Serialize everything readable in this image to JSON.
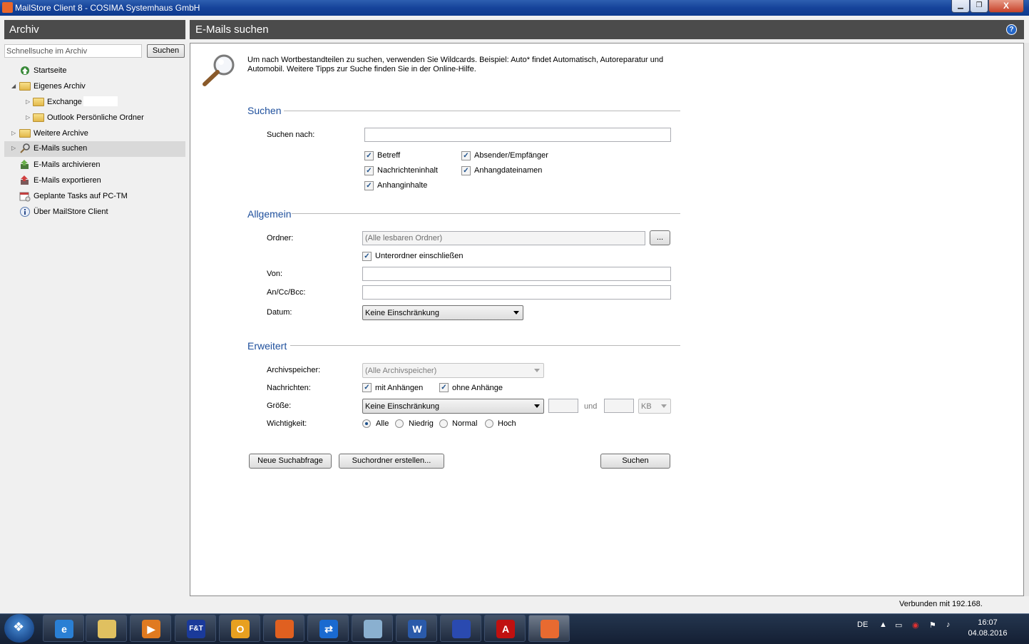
{
  "window": {
    "title": "MailStore Client 8 - COSIMA Systemhaus GmbH",
    "minimize": "▁",
    "maximize": "❐",
    "close": "X"
  },
  "left_pane": {
    "header": "Archiv",
    "quick_search_placeholder": "Schnellsuche im Archiv",
    "quick_search_button": "Suchen",
    "tree": [
      {
        "label": "Startseite",
        "icon": "home-icon"
      },
      {
        "label": "Eigenes Archiv",
        "icon": "folder-icon"
      },
      {
        "label": "Exchange",
        "icon": "folder-icon"
      },
      {
        "label": "Outlook Persönliche Ordner",
        "icon": "folder-icon"
      },
      {
        "label": "Weitere Archive",
        "icon": "folder-icon"
      },
      {
        "label": "E-Mails suchen",
        "icon": "search-icon"
      },
      {
        "label": "E-Mails archivieren",
        "icon": "archive-icon"
      },
      {
        "label": "E-Mails exportieren",
        "icon": "export-icon"
      },
      {
        "label": "Geplante Tasks auf PC-TM",
        "icon": "calendar-icon"
      },
      {
        "label": "Über MailStore Client",
        "icon": "info-icon"
      }
    ]
  },
  "main": {
    "header": "E-Mails suchen",
    "help": "?",
    "intro": "Um nach Wortbestandteilen zu suchen, verwenden Sie Wildcards. Beispiel: Auto* findet Automatisch, Autoreparatur und Automobil. Weitere Tipps zur Suche finden Sie in der Online-Hilfe.",
    "section_search": {
      "title": "Suchen",
      "search_for_label": "Suchen nach:",
      "search_for_value": "",
      "checkboxes": [
        "Betreff",
        "Absender/Empfänger",
        "Nachrichteninhalt",
        "Anhangdateinamen",
        "Anhanginhalte"
      ]
    },
    "section_general": {
      "title": "Allgemein",
      "folder_label": "Ordner:",
      "folder_value": "(Alle lesbaren Ordner)",
      "browse_button": "...",
      "include_subfolders": "Unterordner einschließen",
      "from_label": "Von:",
      "to_label": "An/Cc/Bcc:",
      "date_label": "Datum:",
      "date_value": "Keine Einschränkung"
    },
    "section_advanced": {
      "title": "Erweitert",
      "store_label": "Archivspeicher:",
      "store_value": "(Alle Archivspeicher)",
      "messages_label": "Nachrichten:",
      "with_attachments": "mit Anhängen",
      "without_attachments": "ohne Anhänge",
      "size_label": "Größe:",
      "size_value": "Keine Einschränkung",
      "size_and": "und",
      "size_unit": "KB",
      "priority_label": "Wichtigkeit:",
      "priority_options": [
        "Alle",
        "Niedrig",
        "Normal",
        "Hoch"
      ],
      "priority_selected": "Alle"
    },
    "buttons": {
      "new_query": "Neue Suchabfrage",
      "create_search_folder": "Suchordner erstellen...",
      "search": "Suchen"
    }
  },
  "status_bar": {
    "connection": "Verbunden mit 192.168."
  },
  "taskbar": {
    "apps": [
      {
        "icon": "internet-explorer-icon",
        "glyph": "e",
        "color": "#2a7fd4"
      },
      {
        "icon": "file-explorer-icon",
        "glyph": "",
        "color": "#e0c060"
      },
      {
        "icon": "media-player-icon",
        "glyph": "▶",
        "color": "#e07a20"
      },
      {
        "icon": "ft-soft-icon",
        "glyph": "F&T",
        "color": "#1a3a9a"
      },
      {
        "icon": "outlook-icon",
        "glyph": "O",
        "color": "#e8a020"
      },
      {
        "icon": "firefox-icon",
        "glyph": "",
        "color": "#e06020"
      },
      {
        "icon": "teamviewer-icon",
        "glyph": "⇄",
        "color": "#1a6ad0"
      },
      {
        "icon": "notepad-icon",
        "glyph": "",
        "color": "#8ab0d0"
      },
      {
        "icon": "word-icon",
        "glyph": "W",
        "color": "#2a5aaa"
      },
      {
        "icon": "save-disk-icon",
        "glyph": "",
        "color": "#2a4ab0"
      },
      {
        "icon": "adobe-reader-icon",
        "glyph": "A",
        "color": "#c01010"
      },
      {
        "icon": "mailstore-icon",
        "glyph": "",
        "color": "#e86a30"
      }
    ],
    "language": "DE",
    "time": "16:07",
    "date": "04.08.2016"
  }
}
